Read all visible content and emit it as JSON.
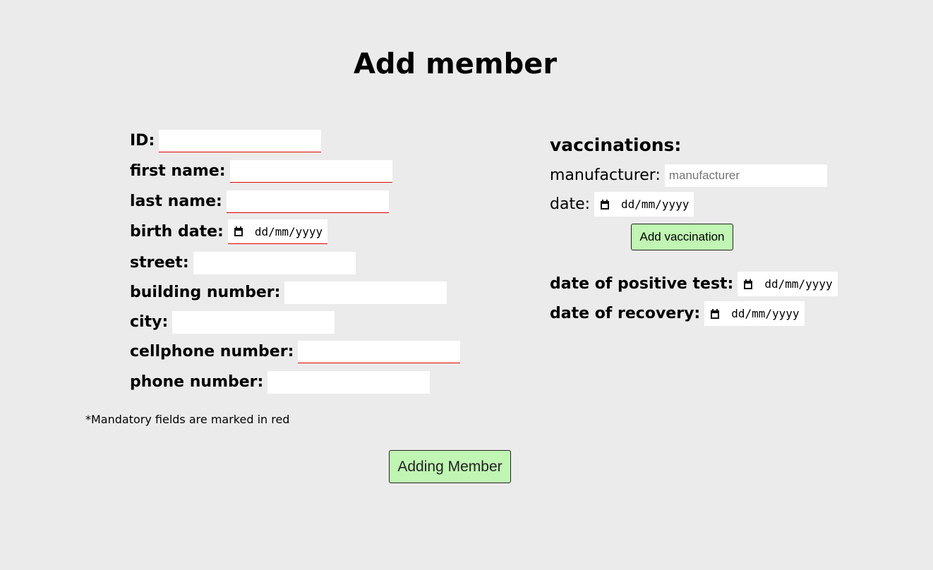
{
  "title": "Add member",
  "member_form": {
    "id_label": "ID:",
    "first_name_label": "first name:",
    "last_name_label": "last name:",
    "birth_date_label": "birth date:",
    "birth_date_placeholder": "dd/mm/yyyy",
    "street_label": "street:",
    "building_number_label": "building number:",
    "city_label": "city:",
    "cellphone_label": "cellphone number:",
    "phone_label": "phone number:"
  },
  "vaccinations": {
    "heading": "vaccinations:",
    "manufacturer_label": "manufacturer:",
    "manufacturer_placeholder": "manufacturer",
    "date_label": "date:",
    "date_placeholder": "dd/mm/yyyy",
    "add_button": "Add vaccination"
  },
  "covid": {
    "positive_test_label": "date of positive test:",
    "positive_test_placeholder": "dd/mm/yyyy",
    "recovery_label": "date of recovery:",
    "recovery_placeholder": "dd/mm/yyyy"
  },
  "mandatory_note": "*Mandatory fields are marked in red",
  "submit_button": "Adding Member",
  "colors": {
    "background": "#ebebeb",
    "button_bg": "#c0f5b3",
    "required_underline": "#e00000"
  }
}
